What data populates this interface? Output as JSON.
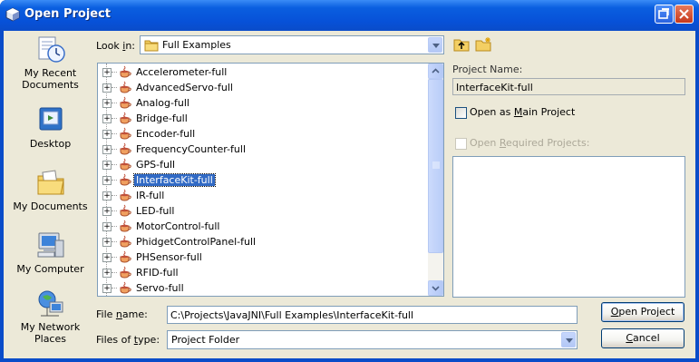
{
  "window": {
    "title": "Open Project"
  },
  "places": [
    {
      "line1": "My Recent",
      "line2": "Documents",
      "icon": "recent-documents-icon"
    },
    {
      "line1": "Desktop",
      "line2": "",
      "icon": "desktop-icon"
    },
    {
      "line1": "My Documents",
      "line2": "",
      "icon": "my-documents-icon"
    },
    {
      "line1": "My Computer",
      "line2": "",
      "icon": "my-computer-icon"
    },
    {
      "line1": "My Network",
      "line2": "Places",
      "icon": "network-places-icon"
    }
  ],
  "look_in": {
    "label_pre": "Look ",
    "label_key": "i",
    "label_post": "n:",
    "value": "Full Examples"
  },
  "tree": {
    "items": [
      "Accelerometer-full",
      "AdvancedServo-full",
      "Analog-full",
      "Bridge-full",
      "Encoder-full",
      "FrequencyCounter-full",
      "GPS-full",
      "InterfaceKit-full",
      "IR-full",
      "LED-full",
      "MotorControl-full",
      "PhidgetControlPanel-full",
      "PHSensor-full",
      "RFID-full",
      "Servo-full"
    ],
    "selected": "InterfaceKit-full"
  },
  "project_name": {
    "label": "Project Name:",
    "value": "InterfaceKit-full"
  },
  "open_as_main": {
    "pre": "Open as ",
    "key": "M",
    "post": "ain Project",
    "checked": false
  },
  "open_required": {
    "pre": "Open ",
    "key": "R",
    "post": "equired Projects:",
    "checked": false,
    "disabled": true
  },
  "file_name": {
    "label_pre": "File ",
    "label_key": "n",
    "label_post": "ame:",
    "value": "C:\\Projects\\JavaJNI\\Full Examples\\InterfaceKit-full"
  },
  "files_of_type": {
    "label_pre": "Files of ",
    "label_key": "t",
    "label_post": "ype:",
    "value": "Project Folder"
  },
  "buttons": {
    "open": {
      "key": "O",
      "rest": "pen Project"
    },
    "cancel": {
      "key": "C",
      "rest": "ancel"
    }
  }
}
